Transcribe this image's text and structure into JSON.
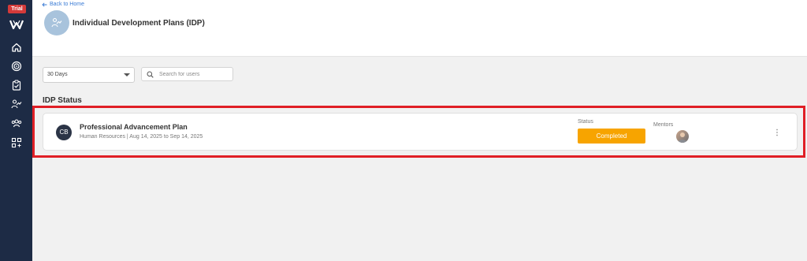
{
  "sidebar": {
    "trial_badge": "Trial",
    "logo": "w-logo-icon",
    "items": [
      {
        "icon": "home-icon"
      },
      {
        "icon": "target-icon"
      },
      {
        "icon": "clipboard-check-icon"
      },
      {
        "icon": "person-growth-icon"
      },
      {
        "icon": "team-icon"
      },
      {
        "icon": "apps-add-icon"
      }
    ],
    "bg_color": "#1d2b45"
  },
  "header": {
    "back_link": "Back to Home",
    "title": "Individual Development Plans (IDP)"
  },
  "filters": {
    "period_selected": "30 Days",
    "search_placeholder": "Search for users"
  },
  "section_title": "IDP Status",
  "plan": {
    "initials": "CB",
    "title": "Professional Advancement Plan",
    "meta": "Human Resources | Aug 14, 2025 to Sep 14, 2025",
    "status_label": "Status",
    "status": "Completed",
    "status_color": "#f7a400",
    "mentors_label": "Mentors"
  },
  "highlight_color": "#e01f26"
}
